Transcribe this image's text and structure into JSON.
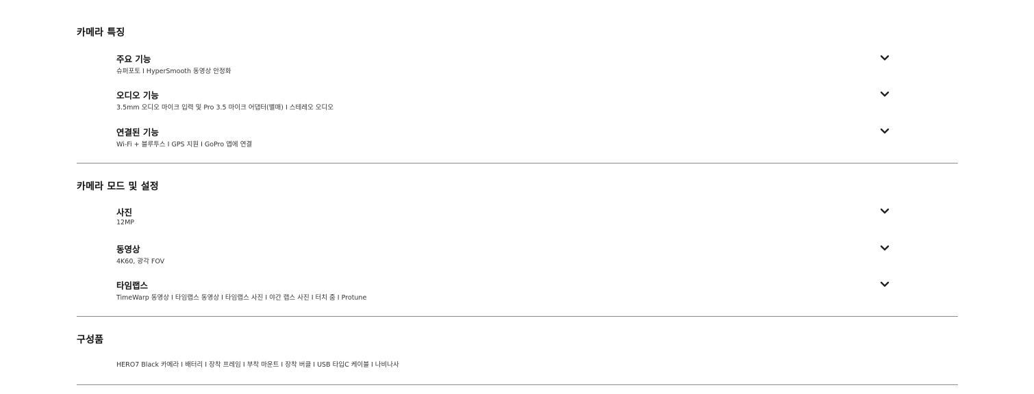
{
  "features": {
    "title": "카메라 특징",
    "items": [
      {
        "title": "주요 기능",
        "desc": "슈퍼포토 I HyperSmooth 동영상 안정화"
      },
      {
        "title": "오디오 기능",
        "desc": "3.5mm 오디오 마이크 입력 및 Pro 3.5 마이크 어댑터(별매) I 스테레오 오디오"
      },
      {
        "title": "연결된 기능",
        "desc": "Wi-Fi + 블루투스 I GPS 지원 I GoPro 앱에 연결"
      }
    ]
  },
  "modes": {
    "title": "카메라 모드 및 설정",
    "items": [
      {
        "title": "사진",
        "desc": "12MP"
      },
      {
        "title": "동영상",
        "desc": "4K60, 광각 FOV"
      },
      {
        "title": "타임랩스",
        "desc": "TimeWarp 동영상 I 타임랩스 동영상 I 타임랩스 사진 I 야간 랩스 사진 I 터치 줌 I Protune"
      }
    ]
  },
  "contents": {
    "title": "구성품",
    "desc": "HERO7 Black 카메라 I 배터리 I 장착 프레임 I 부착 마운트 I 장착 버클 I USB 타입C 케이블 I 나비나사"
  },
  "icons": {
    "expand": "chevron-down-icon"
  },
  "colors": {
    "text": "#111111",
    "secondary_text": "#333333",
    "divider": "#8a8a8a"
  }
}
